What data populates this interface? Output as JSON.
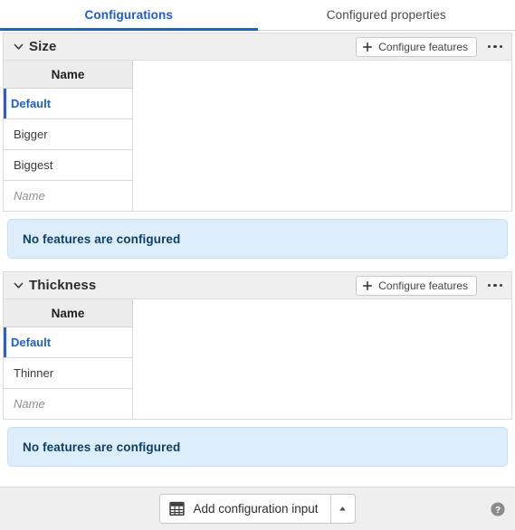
{
  "tabs": [
    {
      "label": "Configurations",
      "active": true
    },
    {
      "label": "Configured properties",
      "active": false
    }
  ],
  "colors": {
    "accent_blue": "#1a5fd8",
    "selected_bar": "#2b5fc4",
    "info_bg": "#dceefb",
    "info_border": "#c2e1f5",
    "info_text": "#0e3f66",
    "header_bg": "#efefef",
    "table_header_bg": "#ececec"
  },
  "sections": [
    {
      "title": "Size",
      "collapse_icon": "chevron-down-icon",
      "configure_button": {
        "label": "Configure features",
        "icon": "plus-icon"
      },
      "overflow_menu": "ellipsis-icon",
      "table": {
        "columns": [
          "Name"
        ],
        "rows": [
          {
            "name": "Default",
            "selected": true,
            "placeholder": false
          },
          {
            "name": "Bigger",
            "selected": false,
            "placeholder": false
          },
          {
            "name": "Biggest",
            "selected": false,
            "placeholder": false
          },
          {
            "name": "Name",
            "selected": false,
            "placeholder": true
          }
        ]
      },
      "info_message": "No features are configured"
    },
    {
      "title": "Thickness",
      "collapse_icon": "chevron-down-icon",
      "configure_button": {
        "label": "Configure features",
        "icon": "plus-icon"
      },
      "overflow_menu": "ellipsis-icon",
      "table": {
        "columns": [
          "Name"
        ],
        "rows": [
          {
            "name": "Default",
            "selected": true,
            "placeholder": false
          },
          {
            "name": "Thinner",
            "selected": false,
            "placeholder": false
          },
          {
            "name": "Name",
            "selected": false,
            "placeholder": true
          }
        ]
      },
      "info_message": "No features are configured"
    }
  ],
  "footer": {
    "add_button": {
      "label": "Add configuration input",
      "icon": "table-grid-icon",
      "caret": "caret-up-icon"
    },
    "help_icon": "help-circle-icon"
  }
}
